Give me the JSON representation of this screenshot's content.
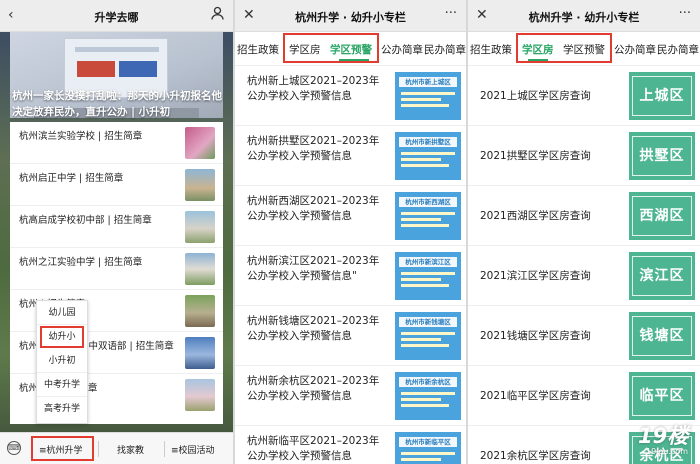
{
  "screen1": {
    "header_title": "升学去哪",
    "banner_caption": "杭州一家长没摸打乱啦：那天的小升初报名他决定放弃民办，直升公办 | 小升初",
    "articles": [
      {
        "title": "杭州滨兰实验学校 | 招生简章"
      },
      {
        "title": "杭州启正中学 | 招生简章"
      },
      {
        "title": "杭高启成学校初中部 | 招生简章"
      },
      {
        "title": "杭州之江实验中学 | 招生简章"
      },
      {
        "title": "杭州        | 招生简章"
      },
      {
        "title": "杭州        爱语中学初中双语部 | 招生简章"
      },
      {
        "title": "杭州        ... | 招生简章"
      }
    ],
    "popup_menu": [
      "幼儿园",
      "幼升小",
      "小升初",
      "中考升学",
      "高考升学"
    ],
    "popup_selected": "幼升小",
    "footer": {
      "keyboard_icon": "keyboard-icon",
      "btn1": "≡杭州升学",
      "btn2": "找家教",
      "btn3": "≡校园活动"
    }
  },
  "screen2": {
    "header_title": "杭州升学 · 幼升小专栏",
    "tabs": [
      "招生政策",
      "学区房",
      "学区预警",
      "公办简章",
      "民办简章"
    ],
    "active_tab": "学区预警",
    "articles": [
      {
        "title": "杭州新上城区2021–2023年公办学校入学预警信息",
        "thumb": "杭州市新上城区"
      },
      {
        "title": "杭州新拱墅区2021–2023年公办学校入学预警信息",
        "thumb": "杭州市新拱墅区"
      },
      {
        "title": "杭州新西湖区2021–2023年公办学校入学预警信息",
        "thumb": "杭州市新西湖区"
      },
      {
        "title": "杭州新滨江区2021–2023年公办学校入学预警信息\"",
        "thumb": "杭州市新滨江区"
      },
      {
        "title": "杭州新钱塘区2021–2023年公办学校入学预警信息",
        "thumb": "杭州市新钱塘区"
      },
      {
        "title": "杭州新余杭区2021–2023年公办学校入学预警信息",
        "thumb": "杭州市新余杭区"
      },
      {
        "title": "杭州新临平区2021–2023年公办学校入学预警信息",
        "thumb": "杭州市新临平区"
      }
    ]
  },
  "screen3": {
    "header_title": "杭州升学 · 幼升小专栏",
    "tabs": [
      "招生政策",
      "学区房",
      "学区预警",
      "公办简章",
      "民办简章"
    ],
    "active_tab": "学区房",
    "articles": [
      {
        "title": "2021上城区学区房查询",
        "thumb": "上城区"
      },
      {
        "title": "2021拱墅区学区房查询",
        "thumb": "拱墅区"
      },
      {
        "title": "2021西湖区学区房查询",
        "thumb": "西湖区"
      },
      {
        "title": "2021滨江区学区房查询",
        "thumb": "滨江区"
      },
      {
        "title": "2021钱塘区学区房查询",
        "thumb": "钱塘区"
      },
      {
        "title": "2021临平区学区房查询",
        "thumb": "临平区"
      },
      {
        "title": "2021余杭区学区房查询",
        "thumb": "余杭区"
      }
    ]
  },
  "watermark": {
    "brand": "19楼",
    "site": "19lou.com"
  },
  "colors": {
    "accent_green": "#2aa566",
    "highlight_red": "#e23b2f",
    "thumb_blue": "#4aa3dc",
    "thumb_green": "#4eb592"
  }
}
